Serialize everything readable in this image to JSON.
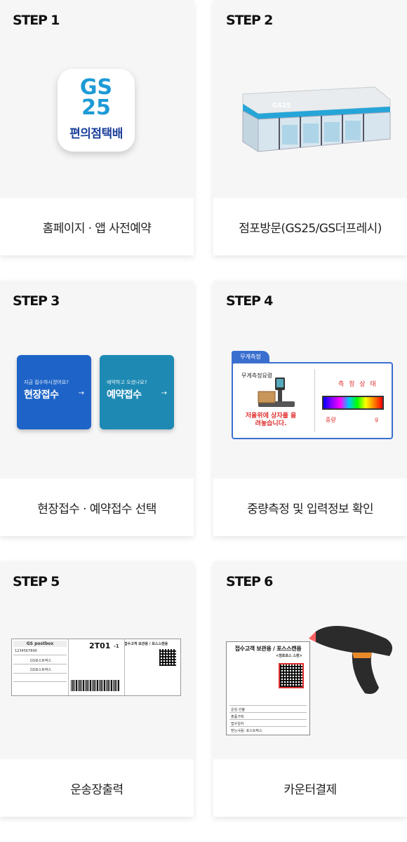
{
  "steps": [
    {
      "label": "STEP 1",
      "caption": "홈페이지 · 앱 사전예약"
    },
    {
      "label": "STEP 2",
      "caption": "점포방문(GS25/GS더프레시)"
    },
    {
      "label": "STEP 3",
      "caption": "현장접수 · 예약접수 선택"
    },
    {
      "label": "STEP 4",
      "caption": "중량측정 및 입력정보 확인"
    },
    {
      "label": "STEP 5",
      "caption": "운송장출력"
    },
    {
      "label": "STEP 6",
      "caption": "카운터결제"
    }
  ],
  "app_icon": {
    "line1": "GS",
    "line2": "25",
    "line3": "편의점택배"
  },
  "store": {
    "sign": "GS25"
  },
  "step3": {
    "onsite": {
      "small": "지금 접수하시겠어요?",
      "big": "현장접수",
      "arrow": "→",
      "color": "#1e64c8"
    },
    "reserve": {
      "small": "예약하고 오셨나요?",
      "big": "예약접수",
      "arrow": "→",
      "color": "#1e8ab4"
    }
  },
  "step4": {
    "tab": "무게측정",
    "scale_label": "무게측정요령",
    "message": "저울위에 상자를 올려놓습니다.",
    "status": "측 정 상 태",
    "unit_left": "중량",
    "unit_right": "g"
  },
  "step5": {
    "header": "GS postbox",
    "code": "2T01",
    "code_suffix": "-1",
    "title": "접수고객 보관용 / 포스스캔용",
    "tracking": "1234567890",
    "sender": "GS포스트박스",
    "receiver": "GS포스트박스"
  },
  "step6": {
    "title": "접수고객 보관용 / 포스스캔용",
    "subtitle": "<점포포스 스캔>",
    "row1": "운임 선불",
    "row2": "출품가택",
    "row3": "접수일자",
    "row4": "받는사람: 포스트박스"
  }
}
